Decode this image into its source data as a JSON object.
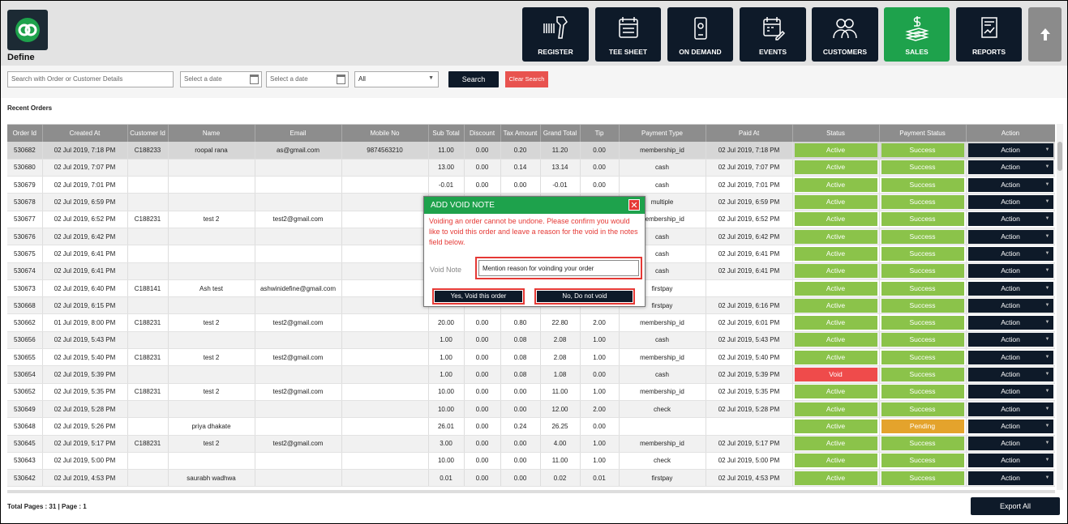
{
  "brand": {
    "name": "Define"
  },
  "nav": [
    {
      "label": "REGISTER",
      "icon": "barcode-scanner-icon"
    },
    {
      "label": "TEE SHEET",
      "icon": "calendar-list-icon"
    },
    {
      "label": "ON DEMAND",
      "icon": "mobile-device-icon"
    },
    {
      "label": "EVENTS",
      "icon": "calendar-edit-icon"
    },
    {
      "label": "CUSTOMERS",
      "icon": "users-icon"
    },
    {
      "label": "SALES",
      "icon": "money-stack-icon",
      "active": true
    },
    {
      "label": "REPORTS",
      "icon": "report-icon"
    }
  ],
  "filters": {
    "search_placeholder": "Search with Order or Customer Details",
    "date_from_placeholder": "Select a date",
    "date_to_placeholder": "Select a date",
    "status_selected": "All",
    "search_label": "Search",
    "clear_label": "Clear Search"
  },
  "section_title": "Recent Orders",
  "table": {
    "headers": [
      "Order Id",
      "Created At",
      "Customer Id",
      "Name",
      "Email",
      "Mobile No",
      "Sub Total",
      "Discount",
      "Tax Amount",
      "Grand Total",
      "Tip",
      "Payment Type",
      "Paid At",
      "Status",
      "Payment Status",
      "Action"
    ],
    "rows": [
      [
        "530682",
        "02 Jul 2019, 7:18 PM",
        "C188233",
        "roopal rana",
        "as@gmail.com",
        "9874563210",
        "11.00",
        "0.00",
        "0.20",
        "11.20",
        "0.00",
        "membership_id",
        "02 Jul 2019, 7:18 PM",
        "Active",
        "Success",
        "Action"
      ],
      [
        "530680",
        "02 Jul 2019, 7:07 PM",
        "",
        "",
        "",
        "",
        "13.00",
        "0.00",
        "0.14",
        "13.14",
        "0.00",
        "cash",
        "02 Jul 2019, 7:07 PM",
        "Active",
        "Success",
        "Action"
      ],
      [
        "530679",
        "02 Jul 2019, 7:01 PM",
        "",
        "",
        "",
        "",
        "-0.01",
        "0.00",
        "0.00",
        "-0.01",
        "0.00",
        "cash",
        "02 Jul 2019, 7:01 PM",
        "Active",
        "Success",
        "Action"
      ],
      [
        "530678",
        "02 Jul 2019, 6:59 PM",
        "",
        "",
        "",
        "",
        "",
        "",
        "",
        "",
        "",
        "multiple",
        "02 Jul 2019, 6:59 PM",
        "Active",
        "Success",
        "Action"
      ],
      [
        "530677",
        "02 Jul 2019, 6:52 PM",
        "C188231",
        "test 2",
        "test2@gmail.com",
        "",
        "",
        "",
        "",
        "",
        "",
        "membership_id",
        "02 Jul 2019, 6:52 PM",
        "Active",
        "Success",
        "Action"
      ],
      [
        "530676",
        "02 Jul 2019, 6:42 PM",
        "",
        "",
        "",
        "",
        "",
        "",
        "",
        "",
        "",
        "cash",
        "02 Jul 2019, 6:42 PM",
        "Active",
        "Success",
        "Action"
      ],
      [
        "530675",
        "02 Jul 2019, 6:41 PM",
        "",
        "",
        "",
        "",
        "",
        "",
        "",
        "",
        "",
        "cash",
        "02 Jul 2019, 6:41 PM",
        "Active",
        "Success",
        "Action"
      ],
      [
        "530674",
        "02 Jul 2019, 6:41 PM",
        "",
        "",
        "",
        "",
        "",
        "",
        "",
        "",
        "",
        "cash",
        "02 Jul 2019, 6:41 PM",
        "Active",
        "Success",
        "Action"
      ],
      [
        "530673",
        "02 Jul 2019, 6:40 PM",
        "C188141",
        "Ash test",
        "ashwinidefine@gmail.com",
        "",
        "",
        "",
        "",
        "",
        "",
        "firstpay",
        "",
        "Active",
        "Success",
        "Action"
      ],
      [
        "530668",
        "02 Jul 2019, 6:15 PM",
        "",
        "",
        "",
        "",
        "",
        "",
        "",
        "",
        "",
        "firstpay",
        "02 Jul 2019, 6:16 PM",
        "Active",
        "Success",
        "Action"
      ],
      [
        "530662",
        "01 Jul 2019, 8:00 PM",
        "C188231",
        "test 2",
        "test2@gmail.com",
        "",
        "20.00",
        "0.00",
        "0.80",
        "22.80",
        "2.00",
        "membership_id",
        "02 Jul 2019, 6:01 PM",
        "Active",
        "Success",
        "Action"
      ],
      [
        "530656",
        "02 Jul 2019, 5:43 PM",
        "",
        "",
        "",
        "",
        "1.00",
        "0.00",
        "0.08",
        "2.08",
        "1.00",
        "cash",
        "02 Jul 2019, 5:43 PM",
        "Active",
        "Success",
        "Action"
      ],
      [
        "530655",
        "02 Jul 2019, 5:40 PM",
        "C188231",
        "test 2",
        "test2@gmail.com",
        "",
        "1.00",
        "0.00",
        "0.08",
        "2.08",
        "1.00",
        "membership_id",
        "02 Jul 2019, 5:40 PM",
        "Active",
        "Success",
        "Action"
      ],
      [
        "530654",
        "02 Jul 2019, 5:39 PM",
        "",
        "",
        "",
        "",
        "1.00",
        "0.00",
        "0.08",
        "1.08",
        "0.00",
        "cash",
        "02 Jul 2019, 5:39 PM",
        "Void",
        "Success",
        "Action"
      ],
      [
        "530652",
        "02 Jul 2019, 5:35 PM",
        "C188231",
        "test 2",
        "test2@gmail.com",
        "",
        "10.00",
        "0.00",
        "0.00",
        "11.00",
        "1.00",
        "membership_id",
        "02 Jul 2019, 5:35 PM",
        "Active",
        "Success",
        "Action"
      ],
      [
        "530649",
        "02 Jul 2019, 5:28 PM",
        "",
        "",
        "",
        "",
        "10.00",
        "0.00",
        "0.00",
        "12.00",
        "2.00",
        "check",
        "02 Jul 2019, 5:28 PM",
        "Active",
        "Success",
        "Action"
      ],
      [
        "530648",
        "02 Jul 2019, 5:26 PM",
        "",
        "priya dhakate",
        "",
        "",
        "26.01",
        "0.00",
        "0.24",
        "26.25",
        "0.00",
        "",
        "",
        "Active",
        "Pending",
        "Action"
      ],
      [
        "530645",
        "02 Jul 2019, 5:17 PM",
        "C188231",
        "test 2",
        "test2@gmail.com",
        "",
        "3.00",
        "0.00",
        "0.00",
        "4.00",
        "1.00",
        "membership_id",
        "02 Jul 2019, 5:17 PM",
        "Active",
        "Success",
        "Action"
      ],
      [
        "530643",
        "02 Jul 2019, 5:00 PM",
        "",
        "",
        "",
        "",
        "10.00",
        "0.00",
        "0.00",
        "11.00",
        "1.00",
        "check",
        "02 Jul 2019, 5:00 PM",
        "Active",
        "Success",
        "Action"
      ],
      [
        "530642",
        "02 Jul 2019, 4:53 PM",
        "",
        "saurabh wadhwa",
        "",
        "",
        "0.01",
        "0.00",
        "0.00",
        "0.02",
        "0.01",
        "firstpay",
        "02 Jul 2019, 4:53 PM",
        "Active",
        "Success",
        "Action"
      ]
    ]
  },
  "footer": {
    "pages": "Total Pages : 31 | Page : 1",
    "export_label": "Export All"
  },
  "modal": {
    "title": "ADD VOID NOTE",
    "close": "✕",
    "message": "Voiding an order cannot be undone. Please confirm you would like to void this order and leave a reason for the void in the notes field below.",
    "note_label": "Void Note",
    "note_value": "Mention reason for voinding your order",
    "confirm_label": "Yes, Void this order",
    "cancel_label": "No, Do not void"
  },
  "colors": {
    "accent": "#1ea24c",
    "dark": "#0e1a29",
    "danger": "#e53935",
    "active": "#8bc34a",
    "pending": "#e4a32c"
  }
}
